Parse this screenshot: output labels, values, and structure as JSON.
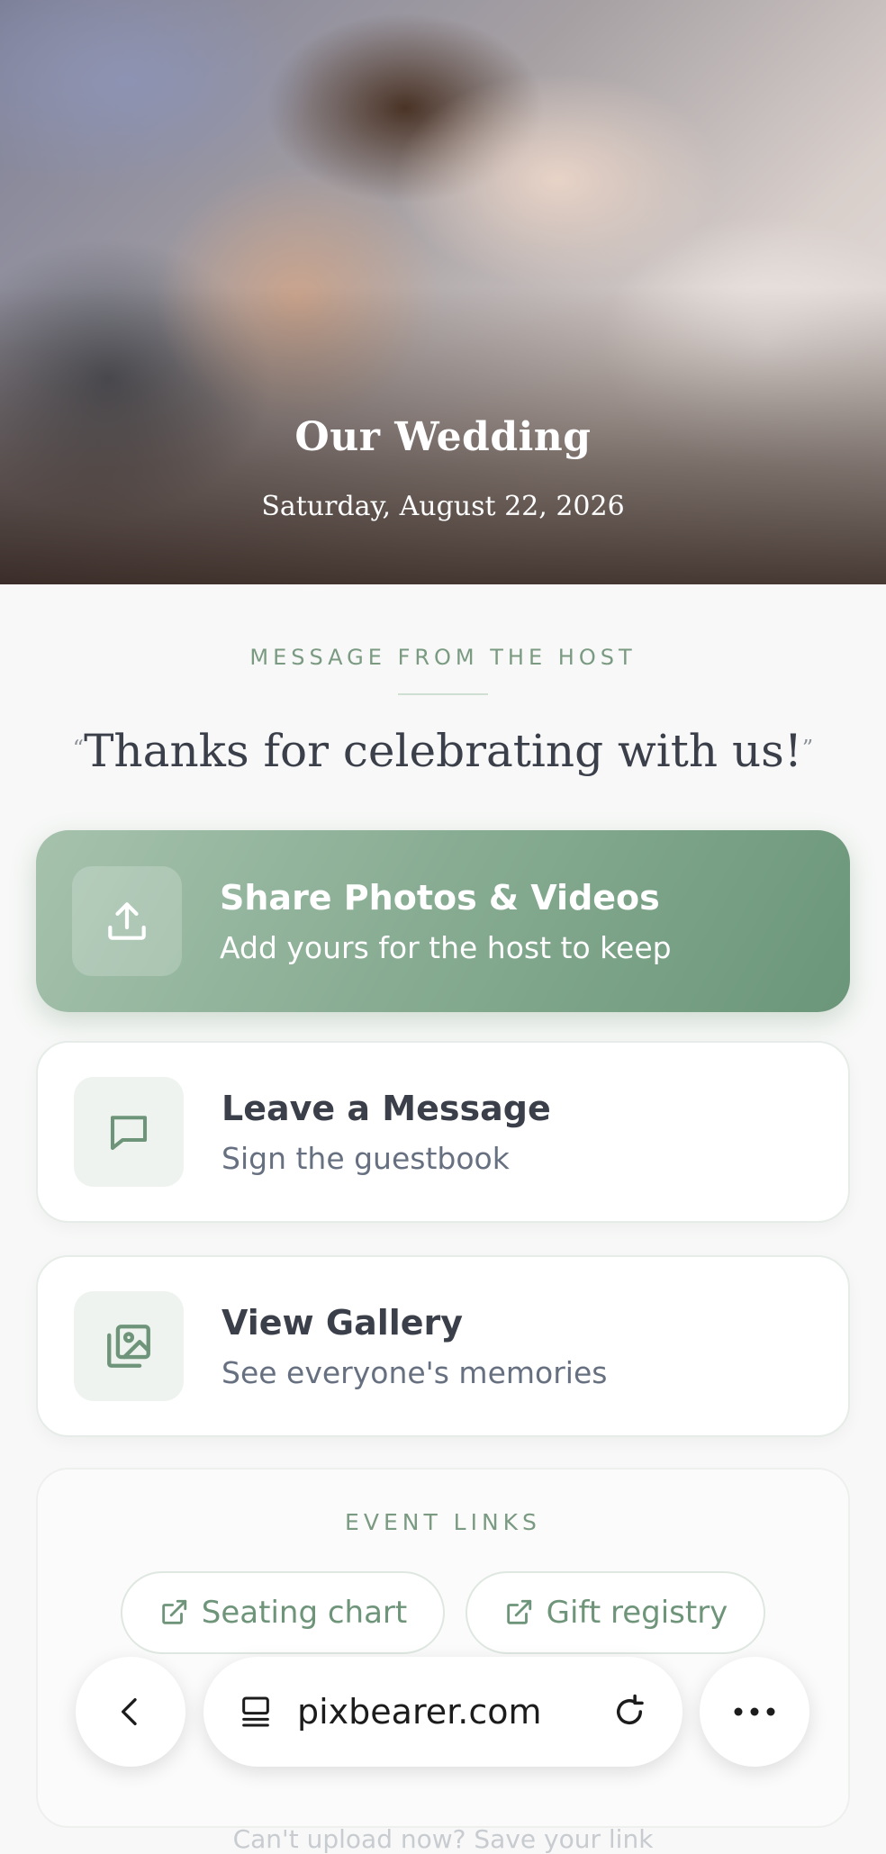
{
  "hero": {
    "title": "Our Wedding",
    "date": "Saturday, August 22, 2026"
  },
  "message": {
    "label": "MESSAGE FROM THE HOST",
    "quote": "Thanks for celebrating with us!",
    "open_quote": "“",
    "close_quote": "”"
  },
  "actions": [
    {
      "title": "Share Photos & Videos",
      "subtitle": "Add yours for the host to keep",
      "icon": "upload-icon"
    },
    {
      "title": "Leave a Message",
      "subtitle": "Sign the guestbook",
      "icon": "message-icon"
    },
    {
      "title": "View Gallery",
      "subtitle": "See everyone's memories",
      "icon": "gallery-icon"
    }
  ],
  "event_links": {
    "label": "EVENT LINKS",
    "links": [
      {
        "label": "Seating chart",
        "icon": "external-link-icon"
      },
      {
        "label": "Gift registry",
        "icon": "external-link-icon"
      }
    ]
  },
  "footer": {
    "text": "Can't upload now? Save your link"
  },
  "browser": {
    "url": "pixbearer.com"
  },
  "colors": {
    "accent": "#7fa68a",
    "accent_dark": "#6b9679",
    "text": "#3a3f4a",
    "muted": "#667080"
  }
}
